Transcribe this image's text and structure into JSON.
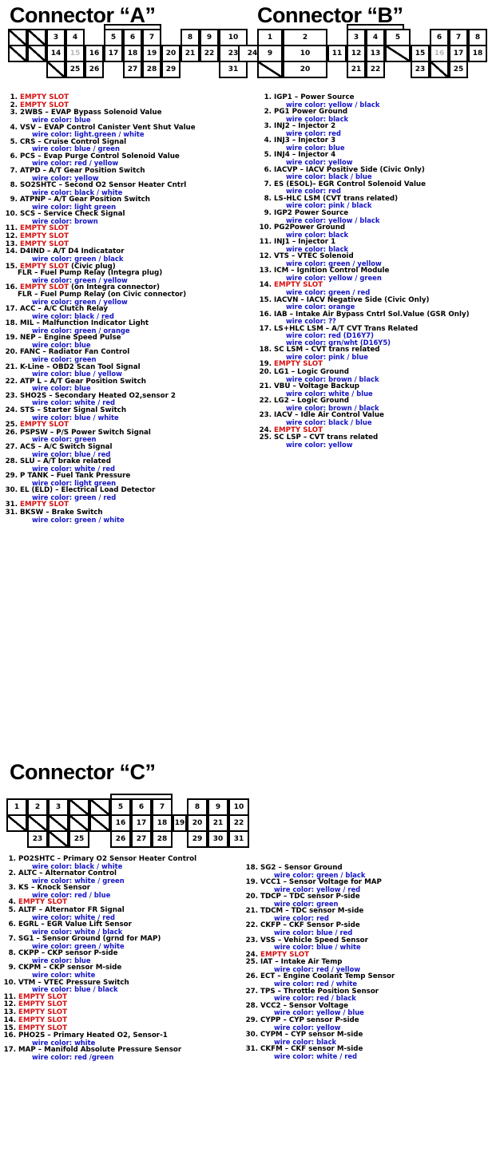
{
  "colors": {
    "empty_red": "#d61111",
    "wire_blue": "#1414c8",
    "text_black": "#000000"
  },
  "connectors": [
    {
      "title": "Connector “A”",
      "grid": {
        "rows": [
          [
            "",
            "",
            "3",
            "4",
            "",
            "5",
            "6",
            "7",
            "",
            "8",
            "9",
            "10",
            ""
          ],
          [
            "",
            "",
            "14",
            "15",
            "16",
            "17",
            "18",
            "19",
            "20",
            "21",
            "22",
            "23",
            "24"
          ],
          [
            "",
            "",
            "",
            "25",
            "26",
            "",
            "27",
            "28",
            "29",
            "",
            "",
            "31",
            ""
          ]
        ]
      },
      "pins": [
        {
          "num": "1.",
          "name": "EMPTY SLOT",
          "empty": true
        },
        {
          "num": "2.",
          "name": "EMPTY SLOT",
          "empty": true
        },
        {
          "num": "3.",
          "name": "2WBS – EVAP Bypass Solenoid Value",
          "wire": "wire color: blue"
        },
        {
          "num": "4.",
          "name": "VSV – EVAP Control Canister Vent Shut Value",
          "wire": "wire color: light.green / white"
        },
        {
          "num": "5.",
          "name": "CRS – Cruise Control Signal",
          "wire": "wire color: blue / green"
        },
        {
          "num": "6.",
          "name": "PCS – Evap Purge Control Solenoid Value",
          "wire": "wire color: red / yellow"
        },
        {
          "num": "7.",
          "name": "ATPD – A/T Gear Position Switch",
          "wire": "wire color: yellow"
        },
        {
          "num": "8.",
          "name": "SO2SHTC – Second O2 Sensor Heater Cntrl",
          "wire": "wire color: black / white"
        },
        {
          "num": "9.",
          "name": "ATPNP – A/T Gear Position Switch",
          "wire": "wire color: light green"
        },
        {
          "num": "10.",
          "name": "SCS – Service Check Signal",
          "wire": "wire color: brown"
        },
        {
          "num": "11.",
          "name": "EMPTY SLOT",
          "empty": true
        },
        {
          "num": "12.",
          "name": "EMPTY SLOT",
          "empty": true
        },
        {
          "num": "13.",
          "name": "EMPTY SLOT",
          "empty": true
        },
        {
          "num": "14.",
          "name": "D4IND – A/T D4 Indicatator",
          "wire": "wire color: green / black"
        },
        {
          "num": "15.",
          "name": "EMPTY SLOT",
          "empty": true,
          "suffix": " (Civic plug)",
          "sub": "FLR – Fuel Pump Relay (Integra plug)",
          "wire": "wire color: green / yellow"
        },
        {
          "num": "16.",
          "name": "EMPTY SLOT",
          "empty": true,
          "suffix": " (on Integra connector)",
          "sub": "FLR – Fuel Pump Relay (on Civic connector)",
          "wire": "wire color: green / yellow"
        },
        {
          "num": "17.",
          "name": "ACC – A/C Clutch Relay",
          "wire": "wire color: black / red"
        },
        {
          "num": "18.",
          "name": "MIL – Malfunction Indicator Light",
          "wire": "wire color: green / orange"
        },
        {
          "num": "19.",
          "name": "NEP – Engine Speed Pulse",
          "wire": "wire color: blue"
        },
        {
          "num": "20.",
          "name": "FANC – Radiator Fan Control",
          "wire": "wire color: green"
        },
        {
          "num": "21.",
          "name": "K-Line – OBD2 Scan Tool Signal",
          "wire": "wire color: blue / yellow"
        },
        {
          "num": "22.",
          "name": "ATP L – A/T Gear Position Switch",
          "wire": "wire color: blue"
        },
        {
          "num": "23.",
          "name": "SHO2S – Secondary Heated O2,sensor 2",
          "wire": "wire color: white / red"
        },
        {
          "num": "24.",
          "name": "STS – Starter Signal Switch",
          "wire": "wire color: blue / white"
        },
        {
          "num": "25.",
          "name": "EMPTY SLOT",
          "empty": true
        },
        {
          "num": "26.",
          "name": "PSPSW – P/S Power Switch Signal",
          "wire": "wire color: green"
        },
        {
          "num": "27.",
          "name": "ACS – A/C Switch Signal",
          "wire": "wire color: blue / red"
        },
        {
          "num": "28.",
          "name": "SLU – A/T brake related",
          "wire": "wire color: white / red"
        },
        {
          "num": "29.",
          "name": "P TANK – Fuel Tank Pressure",
          "wire": "wire color: light green"
        },
        {
          "num": "30.",
          "name": "EL (ELD) – Electrical Load Detector",
          "wire": "wire color: green / red"
        },
        {
          "num": "31.",
          "name": "EMPTY SLOT",
          "empty": true
        },
        {
          "num": "31.",
          "name": "BKSW – Brake Switch",
          "wire": "wire color: green / white"
        }
      ]
    },
    {
      "title": "Connector “B”",
      "grid": {
        "rows": [
          [
            "1",
            "2",
            "",
            "3",
            "4",
            "5",
            "",
            "6",
            "7",
            "8"
          ],
          [
            "9",
            "10",
            "11",
            "12",
            "13",
            "",
            "15",
            "16",
            "17",
            "18"
          ],
          [
            "",
            "20",
            "",
            "21",
            "22",
            "",
            "23",
            "",
            "25",
            ""
          ]
        ]
      },
      "pins": [
        {
          "num": "1.",
          "name": "IGP1 – Power Source",
          "wire": "wire color: yellow / black"
        },
        {
          "num": "2.",
          "name": "PG1 Power Ground",
          "wire": "wire color: black"
        },
        {
          "num": "3.",
          "name": "INJ2 – Injector 2",
          "wire": "wire color: red"
        },
        {
          "num": "4.",
          "name": "INJ3 – Injector 3",
          "wire": "wire color: blue"
        },
        {
          "num": "5.",
          "name": "INJ4 – Injector 4",
          "wire": "wire color: yellow"
        },
        {
          "num": "6.",
          "name": "IACVP – IACV Positive Side (Civic Only)",
          "wire": "wire color: black / blue"
        },
        {
          "num": "7.",
          "name": "ES (ESOL)– EGR Control Solenoid Value",
          "wire": "wire color: red"
        },
        {
          "num": "8.",
          "name": "LS-HLC LSM (CVT trans related)",
          "wire": "wire color: pink / black"
        },
        {
          "num": "9.",
          "name": "IGP2 Power Source",
          "wire": "wire color: yellow / black"
        },
        {
          "num": "10.",
          "name": "PG2Power Ground",
          "wire": "wire color: black"
        },
        {
          "num": "11.",
          "name": "INJ1 – Injector 1",
          "wire": "wire color: black"
        },
        {
          "num": "12.",
          "name": "VTS – VTEC Solenoid",
          "wire": "wire color: green / yellow"
        },
        {
          "num": "13.",
          "name": "ICM – Ignition Control Module",
          "wire": "wire color: yellow / green"
        },
        {
          "num": "14.",
          "name": "EMPTY SLOT",
          "empty": true,
          "wire": "wire color: green / red"
        },
        {
          "num": "15.",
          "name": "IACVN – IACV Negative Side (Civic Only)",
          "wire": "wire color: orange"
        },
        {
          "num": "16.",
          "name": "IAB – Intake Air Bypass Cntrl Sol.Value (GSR Only)",
          "wire": "wire color: ??"
        },
        {
          "num": "17.",
          "name": "LS+HLC LSM – A/T CVT Trans Related",
          "wire": "wire color: red (D16Y7)",
          "wire2": "wire color: grn/wht (D16Y5)"
        },
        {
          "num": "18.",
          "name": "SC LSM – CVT trans related",
          "wire": "wire color: pink / blue"
        },
        {
          "num": "19.",
          "name": "EMPTY SLOT",
          "empty": true
        },
        {
          "num": "20.",
          "name": "LG1 – Logic Ground",
          "wire": "wire color: brown / black"
        },
        {
          "num": "21.",
          "name": "VBU – Voltage Backup",
          "wire": "wire color: white / blue"
        },
        {
          "num": "22.",
          "name": "LG2 – Logic Ground",
          "wire": "wire color: brown / black"
        },
        {
          "num": "23.",
          "name": "IACV – Idle Air Control Value",
          "wire": "wire color: black / blue"
        },
        {
          "num": "24.",
          "name": "EMPTY SLOT",
          "empty": true
        },
        {
          "num": "25.",
          "name": "SC LSP – CVT trans related",
          "wire": "wire color: yellow"
        }
      ]
    },
    {
      "title": "Connector “C”",
      "grid": {
        "rows": [
          [
            "1",
            "2",
            "3",
            "",
            "",
            "5",
            "6",
            "7",
            "",
            "8",
            "9",
            "10"
          ],
          [
            "",
            "",
            "",
            "",
            "",
            "16",
            "17",
            "18",
            "19",
            "20",
            "21",
            "22"
          ],
          [
            "",
            "23",
            "",
            "25",
            "",
            "26",
            "27",
            "28",
            "",
            "29",
            "30",
            "31"
          ]
        ]
      },
      "pins_left": [
        {
          "num": "1.",
          "name": "PO2SHTC – Primary O2 Sensor Heater Control",
          "wire": "wire color: black / white"
        },
        {
          "num": "2.",
          "name": "ALTC – Alternator Control",
          "wire": "wire color: white / green"
        },
        {
          "num": "3.",
          "name": "KS – Knock Sensor",
          "wire": "wire color: red / blue"
        },
        {
          "num": "4.",
          "name": "EMPTY SLOT",
          "empty": true
        },
        {
          "num": "5.",
          "name": "ALTF – Alternator FR Signal",
          "wire": "wire color: white / red"
        },
        {
          "num": "6.",
          "name": "EGRL – EGR Value Lift Sensor",
          "wire": "wire color: white / black"
        },
        {
          "num": "7.",
          "name": "SG1 – Sensor Ground (grnd for MAP)",
          "wire": "wire color: green / white"
        },
        {
          "num": "8.",
          "name": "CKPP – CKP sensor P-side",
          "wire": "wire color: blue"
        },
        {
          "num": "9.",
          "name": "CKPM – CKP sensor M-side",
          "wire": "wire color: white"
        },
        {
          "num": "10.",
          "name": "VTM – VTEC Pressure Switch",
          "wire": "wire color: blue / black"
        },
        {
          "num": "11.",
          "name": "EMPTY SLOT",
          "empty": true
        },
        {
          "num": "12.",
          "name": "EMPTY SLOT",
          "empty": true
        },
        {
          "num": "13.",
          "name": "EMPTY SLOT",
          "empty": true
        },
        {
          "num": "14.",
          "name": "EMPTY SLOT",
          "empty": true
        },
        {
          "num": "15.",
          "name": "EMPTY SLOT",
          "empty": true
        },
        {
          "num": "16.",
          "name": "PHO2S – Primary Heated O2, Sensor-1",
          "wire": "wire color: white"
        },
        {
          "num": "17.",
          "name": "MAP – Manifold Absolute Pressure Sensor",
          "wire": "wire color: red /green"
        }
      ],
      "pins_right": [
        {
          "num": "18.",
          "name": "SG2 – Sensor Ground",
          "wire": "wire color: green / black"
        },
        {
          "num": "19.",
          "name": "VCC1 – Sensor Voltage for MAP",
          "wire": "wire color: yellow / red"
        },
        {
          "num": "20.",
          "name": "TDCP – TDC sensor P-side",
          "wire": "wire color: green"
        },
        {
          "num": "21.",
          "name": "TDCM – TDC sensor M-side",
          "wire": "wire color: red"
        },
        {
          "num": "22.",
          "name": "CKFP – CKF Sensor P-side",
          "wire": "wire color: blue / red"
        },
        {
          "num": "23.",
          "name": "VSS – Vehicle Speed Sensor",
          "wire": "wire color: blue / white"
        },
        {
          "num": "24.",
          "name": "EMPTY SLOT",
          "empty": true
        },
        {
          "num": "25.",
          "name": "IAT – Intake Air Temp",
          "wire": "wire color: red / yellow"
        },
        {
          "num": "26.",
          "name": "ECT – Engine Coolant Temp Sensor",
          "wire": "wire color: red / white"
        },
        {
          "num": "27.",
          "name": "TPS – Throttle Position Sensor",
          "wire": "wire color: red / black"
        },
        {
          "num": "28.",
          "name": "VCC2 – Sensor Voltage",
          "wire": "wire color: yellow / blue"
        },
        {
          "num": "29.",
          "name": "CYPP – CYP sensor P-side",
          "wire": "wire color: yellow"
        },
        {
          "num": "30.",
          "name": "CYPM – CYP sensor M-side",
          "wire": "wire color: black"
        },
        {
          "num": "31.",
          "name": "CKFM – CKF sensor M-side",
          "wire": "wire color: white / red"
        }
      ]
    }
  ]
}
